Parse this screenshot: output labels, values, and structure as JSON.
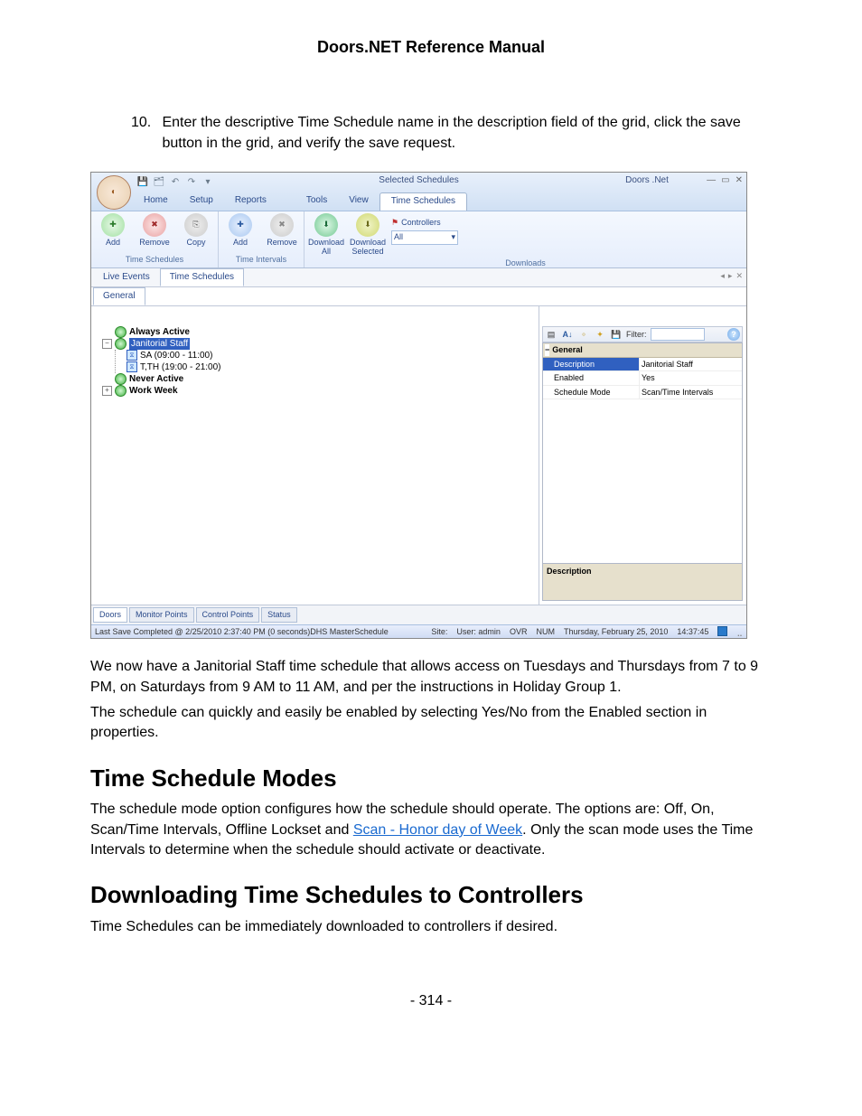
{
  "doc": {
    "title": "Doors.NET Reference Manual",
    "step_number": "10.",
    "step_text": "Enter the descriptive Time Schedule name in the description field of the grid, click the save button in the grid, and verify the save request.",
    "para1": "We now have a Janitorial Staff time schedule that allows access on Tuesdays and Thursdays from 7 to 9 PM, on Saturdays from 9 AM to 11 AM, and per the instructions in Holiday Group 1.",
    "para2": "The schedule can quickly and easily be enabled by selecting Yes/No from the Enabled section in properties.",
    "h2a": "Time Schedule Modes",
    "para3a": "The schedule mode option configures how the schedule should operate. The options are: Off, On, Scan/Time Intervals, Offline Lockset and ",
    "link1": "Scan - Honor day of Week",
    "para3b": ". Only the scan mode uses the Time Intervals to determine when the schedule should activate or deactivate.",
    "h2b": "Downloading Time Schedules to Controllers",
    "para4": "Time Schedules can be immediately downloaded to controllers if desired.",
    "page_number": "- 314 -"
  },
  "app": {
    "title_center": "Selected Schedules",
    "title_right": "Doors .Net",
    "menu": {
      "home": "Home",
      "setup": "Setup",
      "reports": "Reports",
      "tools": "Tools",
      "view": "View",
      "time_schedules": "Time Schedules"
    },
    "ribbon": {
      "ts_group": "Time Schedules",
      "ti_group": "Time Intervals",
      "dl_group": "Downloads",
      "add": "Add",
      "remove": "Remove",
      "copy": "Copy",
      "dl_all_l1": "Download",
      "dl_all_l2": "All",
      "dl_sel_l1": "Download",
      "dl_sel_l2": "Selected",
      "controllers": "Controllers",
      "all_combo": "All"
    },
    "panel_tabs": {
      "live_events": "Live Events",
      "time_schedules": "Time Schedules",
      "general": "General"
    },
    "tree": {
      "always_active": "Always Active",
      "janitorial": "Janitorial Staff",
      "sa": "SA (09:00 - 11:00)",
      "tth": "T,TH (19:00 - 21:00)",
      "never_active": "Never Active",
      "work_week": "Work Week"
    },
    "props": {
      "filter_label": "Filter:",
      "general": "General",
      "k_description": "Description",
      "v_description": "Janitorial Staff",
      "k_enabled": "Enabled",
      "v_enabled": "Yes",
      "k_mode": "Schedule Mode",
      "v_mode": "Scan/Time Intervals",
      "desc_label": "Description"
    },
    "bottom_tabs": {
      "doors": "Doors",
      "monitor_points": "Monitor Points",
      "control_points": "Control Points",
      "status": "Status"
    },
    "status": {
      "left": "Last Save Completed @ 2/25/2010 2:37:40 PM (0 seconds)DHS MasterSchedule",
      "site": "Site:",
      "user": "User: admin",
      "ovr": "OVR",
      "num": "NUM",
      "date": "Thursday, February 25, 2010",
      "time": "14:37:45"
    }
  }
}
